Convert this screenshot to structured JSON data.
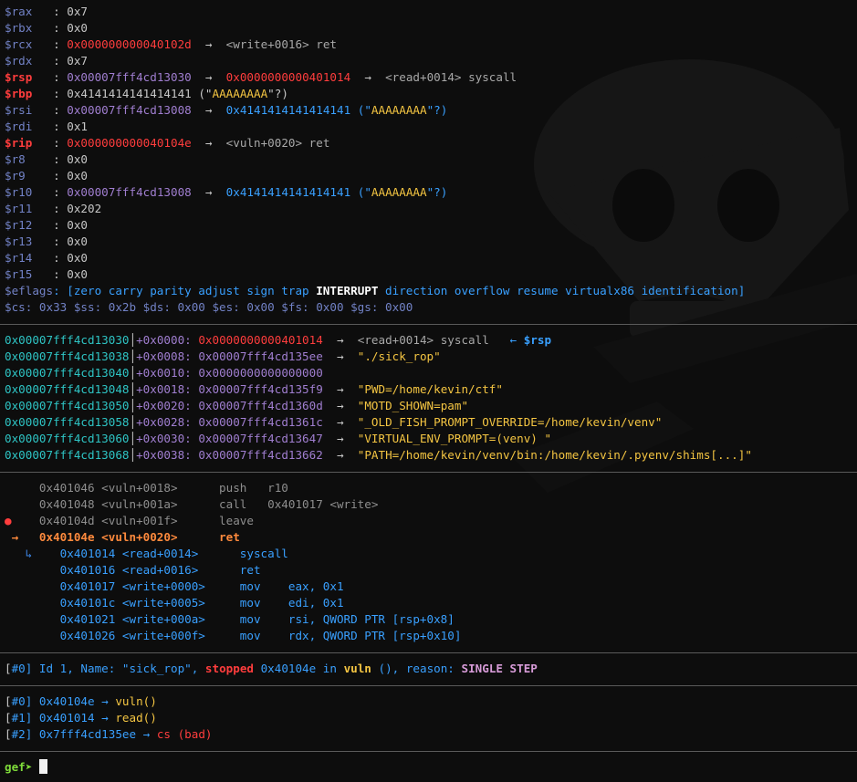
{
  "colors": {
    "default": "#c7c7c7",
    "reg": "#7282c6",
    "changed": "#ff3d3d",
    "stack": "#a07ed0",
    "heap": "#39a0ff",
    "code": "#ff3d3d",
    "string": "#f4c542",
    "symbol": "#a8a8a8",
    "gutter": "#d8d8d8",
    "stackaddr": "#2ec4c4",
    "dim": "#8e8e8e",
    "cur": "#ff8a3d",
    "branch": "#3d86e6",
    "ok": "#7fdc3a",
    "bold": "#ffffff",
    "single": "#d79bd8"
  },
  "lines": [
    [
      [
        "$rax",
        "reg"
      ],
      [
        "   : ",
        "default"
      ],
      [
        "0x7",
        "default"
      ]
    ],
    [
      [
        "$rbx",
        "reg"
      ],
      [
        "   : ",
        "default"
      ],
      [
        "0x0",
        "default"
      ]
    ],
    [
      [
        "$rcx",
        "reg"
      ],
      [
        "   : ",
        "default"
      ],
      [
        "0x000000000040102d",
        "code"
      ],
      [
        "  →  ",
        "default"
      ],
      [
        "<write+0016> ret",
        "symbol"
      ]
    ],
    [
      [
        "$rdx",
        "reg"
      ],
      [
        "   : ",
        "default"
      ],
      [
        "0x7",
        "default"
      ]
    ],
    [
      [
        "$rsp",
        "changed",
        "b"
      ],
      [
        "   : ",
        "default"
      ],
      [
        "0x00007fff4cd13030",
        "stack"
      ],
      [
        "  →  ",
        "default"
      ],
      [
        "0x0000000000401014",
        "code"
      ],
      [
        "  →  ",
        "default"
      ],
      [
        "<read+0014> syscall",
        "symbol"
      ]
    ],
    [
      [
        "$rbp",
        "changed",
        "b"
      ],
      [
        "   : ",
        "default"
      ],
      [
        "0x4141414141414141",
        "default"
      ],
      [
        " (\"",
        "default"
      ],
      [
        "AAAAAAAA",
        "string"
      ],
      [
        "\"?)",
        "default"
      ]
    ],
    [
      [
        "$rsi",
        "reg"
      ],
      [
        "   : ",
        "default"
      ],
      [
        "0x00007fff4cd13008",
        "stack"
      ],
      [
        "  →  ",
        "default"
      ],
      [
        "0x4141414141414141",
        "heap"
      ],
      [
        " (\"",
        "heap"
      ],
      [
        "AAAAAAAA",
        "string"
      ],
      [
        "\"?)",
        "heap"
      ]
    ],
    [
      [
        "$rdi",
        "reg"
      ],
      [
        "   : ",
        "default"
      ],
      [
        "0x1",
        "default"
      ]
    ],
    [
      [
        "$rip",
        "changed",
        "b"
      ],
      [
        "   : ",
        "default"
      ],
      [
        "0x000000000040104e",
        "code"
      ],
      [
        "  →  ",
        "default"
      ],
      [
        "<vuln+0020> ret",
        "symbol"
      ]
    ],
    [
      [
        "$r8 ",
        "reg"
      ],
      [
        "   : ",
        "default"
      ],
      [
        "0x0",
        "default"
      ]
    ],
    [
      [
        "$r9 ",
        "reg"
      ],
      [
        "   : ",
        "default"
      ],
      [
        "0x0",
        "default"
      ]
    ],
    [
      [
        "$r10",
        "reg"
      ],
      [
        "   : ",
        "default"
      ],
      [
        "0x00007fff4cd13008",
        "stack"
      ],
      [
        "  →  ",
        "default"
      ],
      [
        "0x4141414141414141",
        "heap"
      ],
      [
        " (\"",
        "heap"
      ],
      [
        "AAAAAAAA",
        "string"
      ],
      [
        "\"?)",
        "heap"
      ]
    ],
    [
      [
        "$r11",
        "reg"
      ],
      [
        "   : ",
        "default"
      ],
      [
        "0x202",
        "default"
      ]
    ],
    [
      [
        "$r12",
        "reg"
      ],
      [
        "   : ",
        "default"
      ],
      [
        "0x0",
        "default"
      ]
    ],
    [
      [
        "$r13",
        "reg"
      ],
      [
        "   : ",
        "default"
      ],
      [
        "0x0",
        "default"
      ]
    ],
    [
      [
        "$r14",
        "reg"
      ],
      [
        "   : ",
        "default"
      ],
      [
        "0x0",
        "default"
      ]
    ],
    [
      [
        "$r15",
        "reg"
      ],
      [
        "   : ",
        "default"
      ],
      [
        "0x0",
        "default"
      ]
    ],
    [
      [
        "$eflags",
        "reg"
      ],
      [
        ": [zero carry parity adjust sign trap ",
        "heap"
      ],
      [
        "INTERRUPT",
        "bold",
        "b"
      ],
      [
        " direction overflow resume virtualx86 identification]",
        "heap"
      ]
    ],
    [
      [
        "$cs: 0x33 $ss: 0x2b $ds: 0x00 $es: 0x00 $fs: 0x00 $gs: 0x00",
        "reg"
      ]
    ],
    [],
    [
      [
        "0x00007fff4cd13030",
        "stackaddr"
      ],
      [
        "│",
        "default"
      ],
      [
        "+0x0000: ",
        "stack"
      ],
      [
        "0x0000000000401014",
        "code"
      ],
      [
        "  →  ",
        "default"
      ],
      [
        "<read+0014> syscall",
        "symbol"
      ],
      [
        "   ← ",
        "heap"
      ],
      [
        "$rsp",
        "heap",
        "b"
      ]
    ],
    [
      [
        "0x00007fff4cd13038",
        "stackaddr"
      ],
      [
        "│",
        "default"
      ],
      [
        "+0x0008: ",
        "stack"
      ],
      [
        "0x00007fff4cd135ee",
        "stack"
      ],
      [
        "  →  ",
        "default"
      ],
      [
        "\"./sick_rop\"",
        "string"
      ]
    ],
    [
      [
        "0x00007fff4cd13040",
        "stackaddr"
      ],
      [
        "│",
        "default"
      ],
      [
        "+0x0010: ",
        "stack"
      ],
      [
        "0x0000000000000000",
        "stack"
      ]
    ],
    [
      [
        "0x00007fff4cd13048",
        "stackaddr"
      ],
      [
        "│",
        "default"
      ],
      [
        "+0x0018: ",
        "stack"
      ],
      [
        "0x00007fff4cd135f9",
        "stack"
      ],
      [
        "  →  ",
        "default"
      ],
      [
        "\"PWD=/home/kevin/ctf\"",
        "string"
      ]
    ],
    [
      [
        "0x00007fff4cd13050",
        "stackaddr"
      ],
      [
        "│",
        "default"
      ],
      [
        "+0x0020: ",
        "stack"
      ],
      [
        "0x00007fff4cd1360d",
        "stack"
      ],
      [
        "  →  ",
        "default"
      ],
      [
        "\"MOTD_SHOWN=pam\"",
        "string"
      ]
    ],
    [
      [
        "0x00007fff4cd13058",
        "stackaddr"
      ],
      [
        "│",
        "default"
      ],
      [
        "+0x0028: ",
        "stack"
      ],
      [
        "0x00007fff4cd1361c",
        "stack"
      ],
      [
        "  →  ",
        "default"
      ],
      [
        "\"_OLD_FISH_PROMPT_OVERRIDE=/home/kevin/venv\"",
        "string"
      ]
    ],
    [
      [
        "0x00007fff4cd13060",
        "stackaddr"
      ],
      [
        "│",
        "default"
      ],
      [
        "+0x0030: ",
        "stack"
      ],
      [
        "0x00007fff4cd13647",
        "stack"
      ],
      [
        "  →  ",
        "default"
      ],
      [
        "\"VIRTUAL_ENV_PROMPT=(venv) \"",
        "string"
      ]
    ],
    [
      [
        "0x00007fff4cd13068",
        "stackaddr"
      ],
      [
        "│",
        "default"
      ],
      [
        "+0x0038: ",
        "stack"
      ],
      [
        "0x00007fff4cd13662",
        "stack"
      ],
      [
        "  →  ",
        "default"
      ],
      [
        "\"PATH=/home/kevin/venv/bin:/home/kevin/.pyenv/shims[...]\"",
        "string"
      ]
    ],
    [],
    [
      [
        "     0x401046 <vuln+0018>      push   r10",
        "dim"
      ]
    ],
    [
      [
        "     0x401048 <vuln+001a>      call   0x401017 <write>",
        "dim"
      ]
    ],
    [
      [
        "●",
        "changed"
      ],
      [
        "    0x40104d <vuln+001f>      leave",
        "dim"
      ]
    ],
    [
      [
        " →   0x40104e <vuln+0020>      ret",
        "cur",
        "b"
      ]
    ],
    [
      [
        "   ↳",
        "branch"
      ],
      [
        "    0x401014 <read+0014>      syscall",
        "heap"
      ]
    ],
    [
      [
        "        0x401016 <read+0016>      ret",
        "heap"
      ]
    ],
    [
      [
        "        0x401017 <write+0000>     mov    eax, 0x1",
        "heap"
      ]
    ],
    [
      [
        "        0x40101c <write+0005>     mov    edi, 0x1",
        "heap"
      ]
    ],
    [
      [
        "        0x401021 <write+000a>     mov    rsi, QWORD PTR [rsp+0x8]",
        "heap"
      ]
    ],
    [
      [
        "        0x401026 <write+000f>     mov    rdx, QWORD PTR [rsp+0x10]",
        "heap"
      ]
    ],
    [],
    [
      [
        "[",
        "default"
      ],
      [
        "#0",
        "heap"
      ],
      [
        "] Id 1, Name: \"sick_rop\", ",
        "heap"
      ],
      [
        "stopped",
        "changed",
        "b"
      ],
      [
        " 0x40104e in ",
        "heap"
      ],
      [
        "vuln",
        "string",
        "b"
      ],
      [
        " (), reason: ",
        "heap"
      ],
      [
        "SINGLE STEP",
        "single",
        "b"
      ]
    ],
    [],
    [
      [
        "[",
        "default"
      ],
      [
        "#0",
        "heap"
      ],
      [
        "] 0x40104e → ",
        "heap"
      ],
      [
        "vuln()",
        "string"
      ]
    ],
    [
      [
        "[",
        "default"
      ],
      [
        "#1",
        "heap"
      ],
      [
        "] 0x401014 → ",
        "heap"
      ],
      [
        "read()",
        "string"
      ]
    ],
    [
      [
        "[",
        "default"
      ],
      [
        "#2",
        "heap"
      ],
      [
        "] 0x7fff4cd135ee → ",
        "heap"
      ],
      [
        "cs (bad)",
        "code"
      ]
    ],
    [],
    [
      [
        "gef➤ ",
        "ok",
        "b"
      ]
    ]
  ],
  "prompt": "gef➤"
}
